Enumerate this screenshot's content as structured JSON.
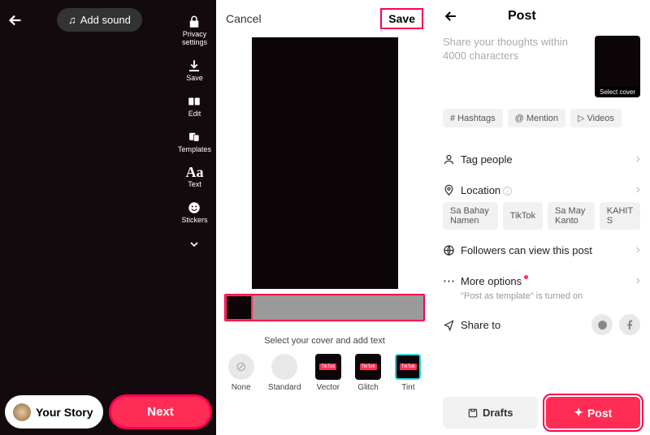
{
  "pane1": {
    "add_sound": "Add sound",
    "tools": [
      {
        "label": "Privacy\nsettings",
        "icon": "lock-icon"
      },
      {
        "label": "Save",
        "icon": "download-icon"
      },
      {
        "label": "Edit",
        "icon": "edit-icon"
      },
      {
        "label": "Templates",
        "icon": "templates-icon"
      },
      {
        "label": "Text",
        "icon": "text-icon"
      },
      {
        "label": "Stickers",
        "icon": "stickers-icon"
      }
    ],
    "your_story": "Your Story",
    "next": "Next"
  },
  "pane2": {
    "cancel": "Cancel",
    "save": "Save",
    "instruction": "Select your cover and add text",
    "styles": [
      {
        "label": "None"
      },
      {
        "label": "Standard"
      },
      {
        "label": "Vector"
      },
      {
        "label": "Glitch"
      },
      {
        "label": "Tint"
      }
    ]
  },
  "pane3": {
    "title": "Post",
    "caption_placeholder": "Share your thoughts within 4000 characters",
    "select_cover": "Select cover",
    "chips": {
      "hashtags": "# Hashtags",
      "mention": "@ Mention",
      "videos": "Videos"
    },
    "rows": {
      "tag_people": "Tag people",
      "location": "Location",
      "visibility": "Followers can view this post",
      "more_options": "More options",
      "more_options_sub": "\"Post as template\" is turned on",
      "share_to": "Share to"
    },
    "location_chips": [
      "Sa Bahay Namen",
      "TikTok",
      "Sa May Kanto",
      "KAHIT S"
    ],
    "drafts": "Drafts",
    "post": "Post"
  },
  "colors": {
    "accent": "#ff2d55",
    "highlight": "#ff0050"
  }
}
